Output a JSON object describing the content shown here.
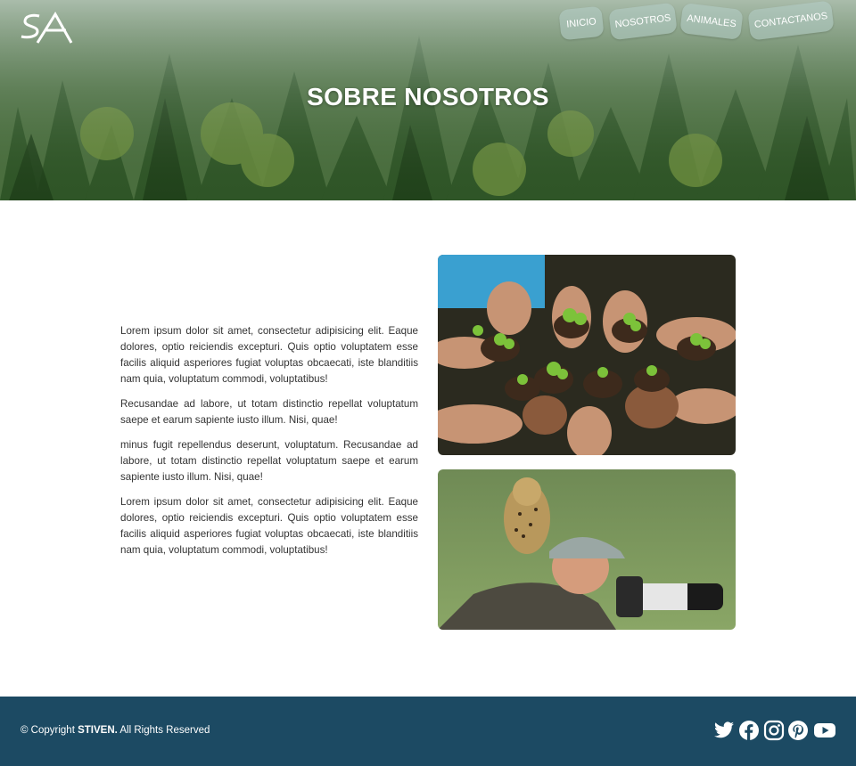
{
  "header": {
    "logo_text": "SA",
    "title": "SOBRE NOSOTROS",
    "nav": [
      {
        "label": "INICIO"
      },
      {
        "label": "NOSOTROS"
      },
      {
        "label": "ANIMALES"
      },
      {
        "label": "CONTACTANOS"
      }
    ]
  },
  "main": {
    "paragraphs": [
      "Lorem ipsum dolor sit amet, consectetur adipisicing elit. Eaque dolores, optio reiciendis excepturi. Quis optio voluptatem esse facilis aliquid asperiores fugiat voluptas obcaecati, iste blanditiis nam quia, voluptatum commodi, voluptatibus!",
      "Recusandae ad labore, ut totam distinctio repellat voluptatum saepe et earum sapiente iusto illum. Nisi, quae!",
      "minus fugit repellendus deserunt, voluptatum. Recusandae ad labore, ut totam distinctio repellat voluptatum saepe et earum sapiente iusto illum. Nisi, quae!",
      "Lorem ipsum dolor sit amet, consectetur adipisicing elit. Eaque dolores, optio reiciendis excepturi. Quis optio voluptatem esse facilis aliquid asperiores fugiat voluptas obcaecati, iste blanditiis nam quia, voluptatum commodi, voluptatibus!"
    ]
  },
  "footer": {
    "copyright_prefix": "© Copyright ",
    "copyright_brand": "STIVEN.",
    "copyright_suffix": " All Rights Reserved",
    "social_icons": [
      "twitter-icon",
      "facebook-icon",
      "instagram-icon",
      "pinterest-icon",
      "youtube-icon"
    ]
  },
  "colors": {
    "footer_bg": "#1c4a63",
    "nav_button_bg": "rgba(180,205,200,0.55)",
    "text": "#333333"
  }
}
